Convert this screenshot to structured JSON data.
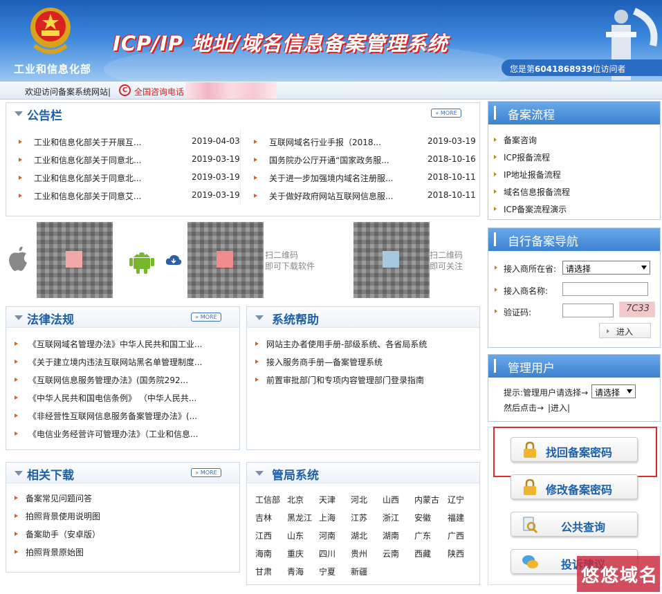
{
  "header": {
    "ministry": "工业和信息化部",
    "title": "ICP/IP 地址/域名信息备案管理系统",
    "visitor_prefix": "您是第",
    "visitor_count": "6041868939",
    "visitor_suffix": "位访问者"
  },
  "welcome": {
    "text": "欢迎访问备案系统网站|",
    "phone_label": "全国咨询电话"
  },
  "notices": {
    "title": "公告栏",
    "more": "» MORE",
    "left": [
      {
        "text": "工业和信息化部关于开展互...",
        "date": "2019-04-03"
      },
      {
        "text": "工业和信息化部关于同意北...",
        "date": "2019-03-19"
      },
      {
        "text": "工业和信息化部关于同意北...",
        "date": "2019-03-19"
      },
      {
        "text": "工业和信息化部关于同意艾...",
        "date": "2019-03-19"
      }
    ],
    "right": [
      {
        "text": "互联网域名行业手报（2018...",
        "date": "2019-03-19"
      },
      {
        "text": "国务院办公厅开通“国家政务服...",
        "date": "2018-10-16"
      },
      {
        "text": "关于进一步加强境内域名注册服...",
        "date": "2018-10-11"
      },
      {
        "text": "关于做好政府网站互联网信息服...",
        "date": "2018-10-11"
      }
    ]
  },
  "apps": {
    "qr1_text_a": "扫二维码",
    "qr1_text_b": "即可下载软件",
    "qr2_text_a": "扫二维码",
    "qr2_text_b": "即可关注"
  },
  "laws": {
    "title": "法律法规",
    "more": "» MORE",
    "items": [
      "《互联网域名管理办法》中华人民共和国工业...",
      "《关于建立境内违法互联网站黑名单管理制度...",
      "《互联网信息服务管理办法》(国务院292...",
      "《中华人民共和国电信条例》 （中华人民共...",
      "《非经营性互联网信息服务备案管理办法》(...",
      "《电信业务经营许可管理办法》（工业和信息..."
    ]
  },
  "help": {
    "title": "系统帮助",
    "items": [
      "网站主办者使用手册-部级系统、各省局系统",
      "接入服务商手册—备案管理系统",
      "前置审批部门和专项内容管理部门登录指南"
    ]
  },
  "downloads": {
    "title": "相关下载",
    "more": "» MORE",
    "items": [
      "备案常见问题问答",
      "拍照背景使用说明图",
      "备案助手（安卓版）",
      "拍照背景原始图"
    ]
  },
  "bureau": {
    "title": "管局系统",
    "provinces": [
      [
        "工信部",
        "北京",
        "天津",
        "河北",
        "山西",
        "内蒙古",
        "辽宁"
      ],
      [
        "吉林",
        "黑龙江",
        "上海",
        "江苏",
        "浙江",
        "安徽",
        "福建"
      ],
      [
        "江西",
        "山东",
        "河南",
        "湖北",
        "湖南",
        "广东",
        "广西"
      ],
      [
        "海南",
        "重庆",
        "四川",
        "贵州",
        "云南",
        "西藏",
        "陕西"
      ],
      [
        "甘肃",
        "青海",
        "宁夏",
        "新疆"
      ]
    ]
  },
  "flow": {
    "title": "备案流程",
    "items": [
      "备案咨询",
      "ICP报备流程",
      "IP地址报备流程",
      "域名信息报备流程",
      "ICP备案流程演示"
    ]
  },
  "nav": {
    "title": "自行备案导航",
    "isp_location_label": "接入商所在省:",
    "isp_location_value": "请选择",
    "isp_name_label": "接入商名称:",
    "captcha_label": "验证码:",
    "captcha_text": "7C33",
    "enter": "进入"
  },
  "admin": {
    "title": "管理用户",
    "hint": "提示:管理用户请选择→",
    "select_value": "请选择",
    "then": "然后点击→",
    "enter": "|进入|"
  },
  "buttons": {
    "retrieve": "找回备案密码",
    "modify": "修改备案密码",
    "query": "公共查询",
    "complaint": "投诉建议"
  },
  "watermark": "悠悠域名",
  "colors": {
    "accent": "#1d5fa8",
    "highlight": "#e8252b"
  }
}
